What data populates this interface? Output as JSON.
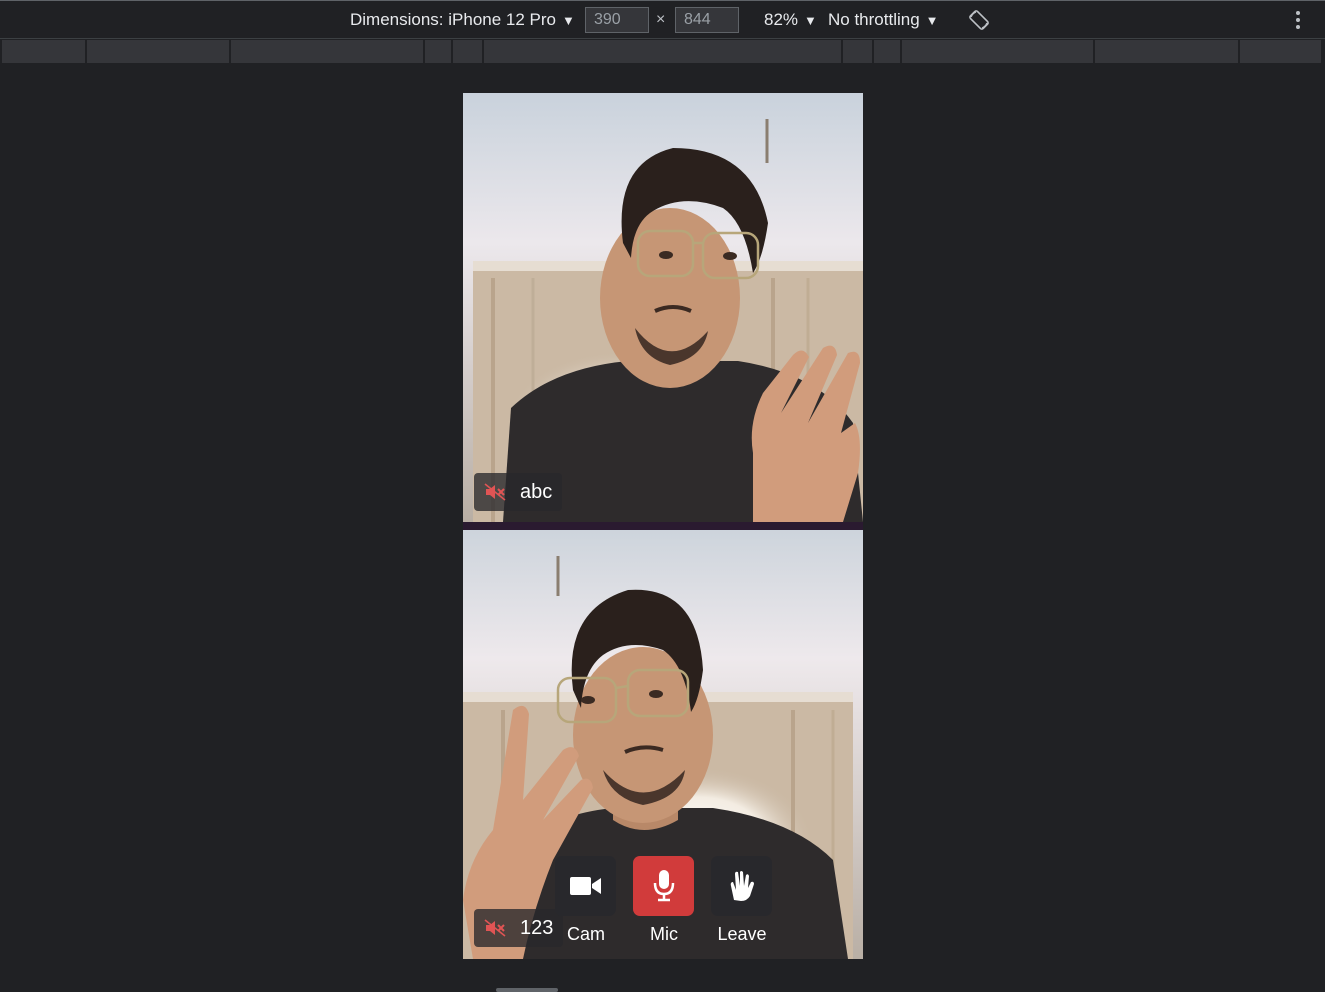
{
  "devtools": {
    "dimensions_label": "Dimensions: iPhone 12 Pro",
    "width_value": "390",
    "height_value": "844",
    "times_sign": "×",
    "zoom": "82%",
    "throttling": "No throttling"
  },
  "call": {
    "participants": [
      {
        "name": "abc",
        "muted": true
      },
      {
        "name": "123",
        "muted": true
      }
    ],
    "controls": {
      "cam_label": "Cam",
      "mic_label": "Mic",
      "leave_label": "Leave"
    },
    "colors": {
      "mic_active": "#d13b3b",
      "muted_icon": "#e05454",
      "control_bg": "#28282c"
    }
  }
}
